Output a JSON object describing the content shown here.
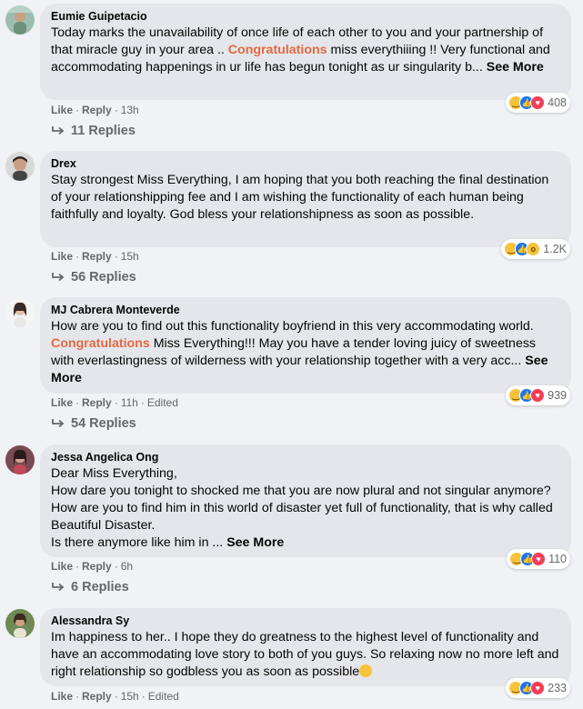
{
  "comments": [
    {
      "author": "Eumie Guipetacio",
      "text_before": "Today marks the unavailability of once life of each other to you and your partnership of that miracle guy in your area .. ",
      "highlight": "Congratulations",
      "text_after": " miss everythiiing !! Very functional and accommodating happenings in ur life has begun tonight as ur singularity b... ",
      "see_more": "See More",
      "reaction_count": "408",
      "reaction_icons": [
        "haha-icon",
        "like-icon",
        "love-icon"
      ],
      "like": "Like",
      "reply": "Reply",
      "time": "13h",
      "edited": "",
      "replies": "11 Replies"
    },
    {
      "author": "Drex",
      "text_before": "Stay strongest Miss Everything, I am hoping that you both reaching the final destination of your relationshipping fee and I am wishing the functionality of each human being faithfully and loyalty. God bless your relationshipness as soon as possible.",
      "highlight": "",
      "text_after": "",
      "see_more": "",
      "reaction_count": "1.2K",
      "reaction_icons": [
        "haha-icon",
        "like-icon",
        "wow-icon"
      ],
      "like": "Like",
      "reply": "Reply",
      "time": "15h",
      "edited": "",
      "replies": "56 Replies"
    },
    {
      "author": "MJ Cabrera Monteverde",
      "text_before": "How are you to find out this functionality boyfriend in this very accommodating world. ",
      "highlight": "Congratulations",
      "text_after": " Miss Everything!!! May you have a tender loving juicy of sweetness with everlastingness of wilderness with your relationship together with a very acc... ",
      "see_more": "See More",
      "reaction_count": "939",
      "reaction_icons": [
        "haha-icon",
        "like-icon",
        "love-icon"
      ],
      "like": "Like",
      "reply": "Reply",
      "time": "11h",
      "edited": "Edited",
      "replies": "54 Replies"
    },
    {
      "author": "Jessa Angelica Ong",
      "text_before": "Dear Miss Everything,\nHow dare you tonight to shocked me that you are now plural and not singular anymore? How are you to find him in this world of disaster yet full of functionality, that is why called Beautiful Disaster.\nIs there anymore like him in ... ",
      "highlight": "",
      "text_after": "",
      "see_more": "See More",
      "reaction_count": "110",
      "reaction_icons": [
        "haha-icon",
        "like-icon",
        "love-icon"
      ],
      "like": "Like",
      "reply": "Reply",
      "time": "6h",
      "edited": "",
      "replies": "6 Replies"
    },
    {
      "author": "Alessandra Sy",
      "text_before": "Im happiness to her.. I hope they do greatness to the highest level of functionality and have an accommodating love story to both of you guys. So relaxing now no more left and right relationship so godbless you as soon as possible",
      "highlight": "",
      "text_after": "",
      "see_more": "",
      "reaction_count": "233",
      "reaction_icons": [
        "haha-icon",
        "like-icon",
        "love-icon"
      ],
      "like": "Like",
      "reply": "Reply",
      "time": "15h",
      "edited": "Edited",
      "replies": ""
    }
  ],
  "colors": {
    "highlight": "#e4693e",
    "bubble": "#e4e6eb",
    "muted": "#65676b"
  }
}
